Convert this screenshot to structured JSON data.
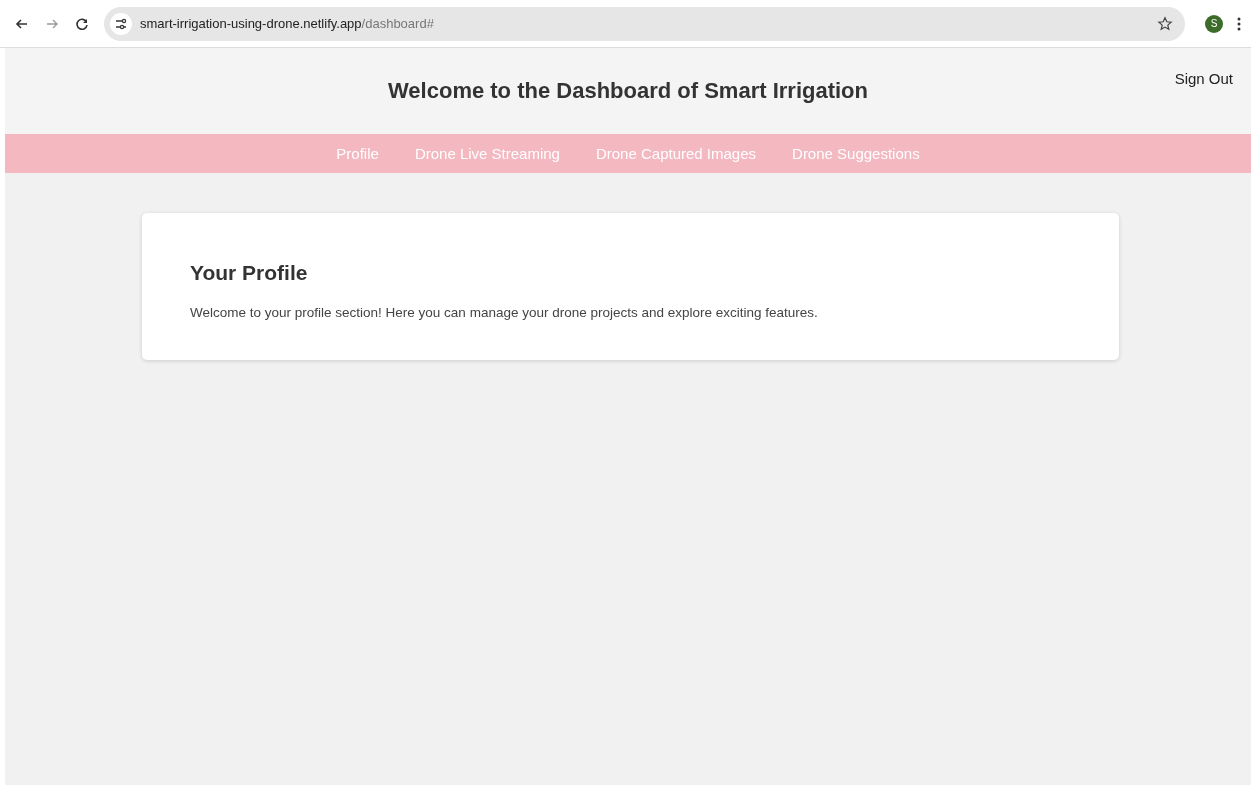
{
  "browser": {
    "url_host": "smart-irrigation-using-drone.netlify.app",
    "url_path": "/dashboard#",
    "avatar": "S"
  },
  "header": {
    "title": "Welcome to the Dashboard of Smart Irrigation",
    "sign_out": "Sign Out"
  },
  "nav": {
    "items": [
      "Profile",
      "Drone Live Streaming",
      "Drone Captured Images",
      "Drone Suggestions"
    ]
  },
  "card": {
    "title": "Your Profile",
    "text": "Welcome to your profile section! Here you can manage your drone projects and explore exciting features."
  }
}
